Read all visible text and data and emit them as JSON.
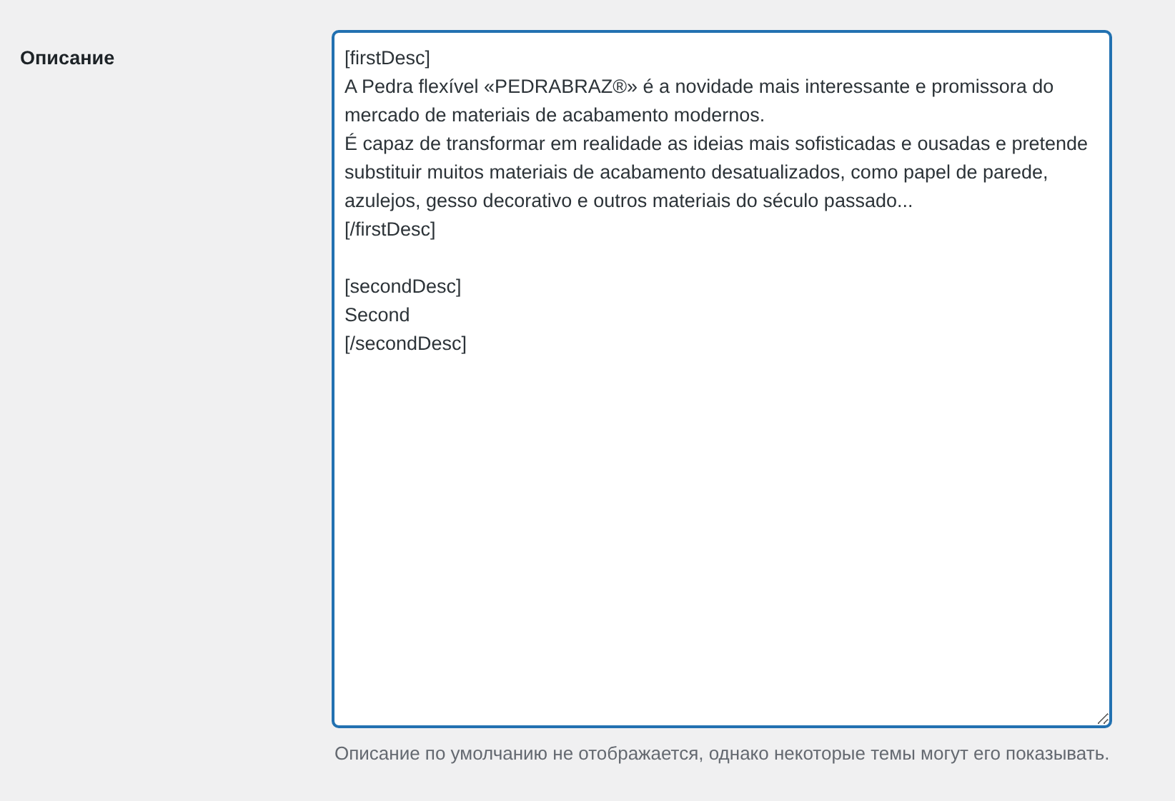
{
  "field": {
    "label": "Описание",
    "focused": true,
    "value": "[firstDesc]\nA Pedra flexível «PEDRABRAZ®» é a novidade mais interessante e promissora do mercado de materiais de acabamento modernos.\nÉ capaz de transformar em realidade as ideias mais sofisticadas e ousadas e pretende substituir muitos materiais de acabamento desatualizados, como papel de parede, azulejos, gesso decorativo e outros materiais do século passado...\n[/firstDesc]\n\n[secondDesc]\nSecond\n[/secondDesc]",
    "hint": "Описание по умолчанию не отображается, однако некоторые темы могут его показывать."
  }
}
